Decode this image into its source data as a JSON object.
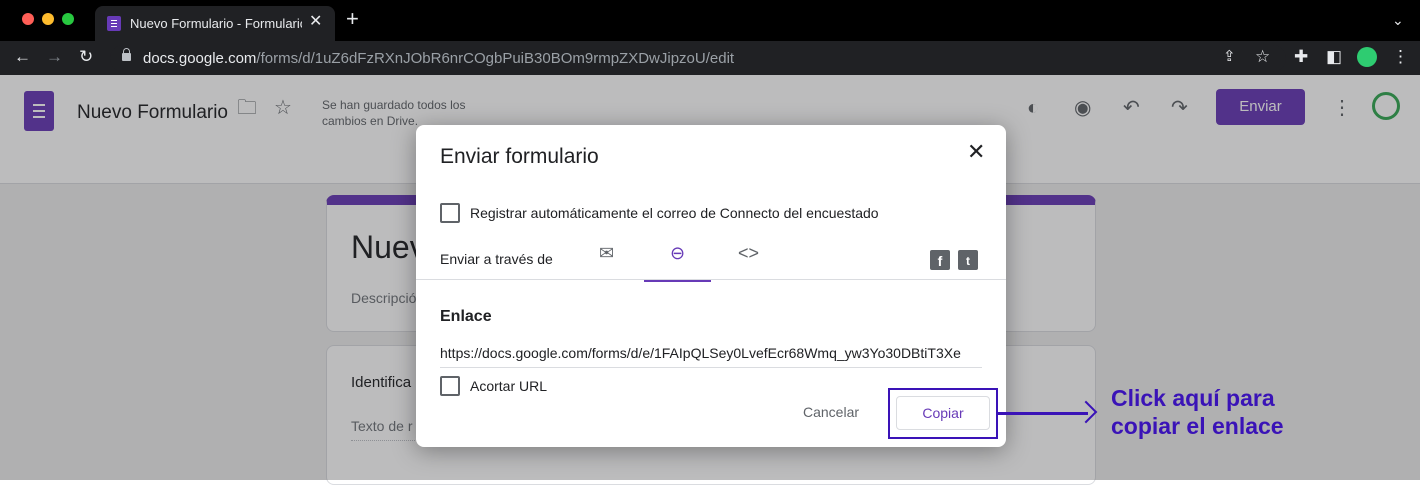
{
  "browser": {
    "tab_title": "Nuevo Formulario - Formulario",
    "url_host": "docs.google.com",
    "url_path": "/forms/d/1uZ6dFzRXnJObR6nrCOgbPuiB30BOm9rmpZXDwJipzoU/edit"
  },
  "forms_header": {
    "title": "Nuevo Formulario",
    "save_status": "Se han guardado todos los cambios en Drive.",
    "send_label": "Enviar"
  },
  "background_form": {
    "title": "Nuevo",
    "description": "Descripción",
    "question": "Identifica",
    "answer_placeholder": "Texto de r"
  },
  "dialog": {
    "title": "Enviar formulario",
    "collect_email_label": "Registrar automáticamente el correo de Connecto del encuestado",
    "send_via_label": "Enviar a través de",
    "link_heading": "Enlace",
    "link_url": "https://docs.google.com/forms/d/e/1FAIpQLSey0LvefEcr68Wmq_yw3Yo30DBtiT3Xe",
    "shorten_url_label": "Acortar URL",
    "cancel_label": "Cancelar",
    "copy_label": "Copiar"
  },
  "annotation": {
    "note_line1": "Click aquí para",
    "note_line2": "copiar el enlace"
  },
  "colors": {
    "accent": "#673ab7",
    "annotation": "#3a13b7"
  }
}
